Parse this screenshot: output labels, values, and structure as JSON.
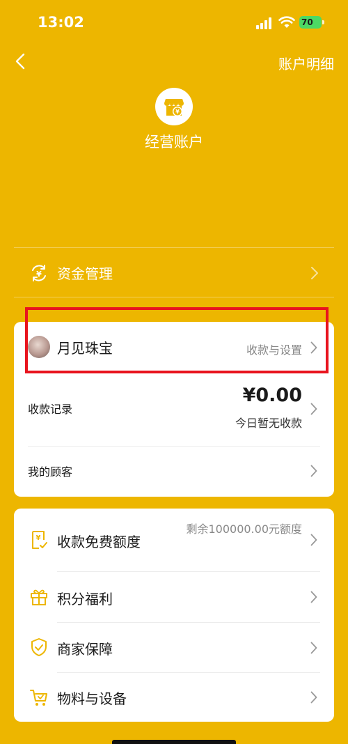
{
  "status_bar": {
    "time": "13:02",
    "battery": "70"
  },
  "nav": {
    "right_label": "账户明细"
  },
  "hero": {
    "title": "经营账户",
    "icon": "shop-yen-icon"
  },
  "fund": {
    "label": "资金管理",
    "icon": "yen-cycle-icon"
  },
  "merchant": {
    "name": "月见珠宝",
    "link_label": "收款与设置"
  },
  "records": {
    "label": "收款记录",
    "amount": "¥0.00",
    "subtext": "今日暂无收款"
  },
  "customers": {
    "label": "我的顾客"
  },
  "services": [
    {
      "label": "收款免费额度",
      "note": "剩余100000.00元额度",
      "icon": "yen-receipt-icon"
    },
    {
      "label": "积分福利",
      "icon": "gift-icon"
    },
    {
      "label": "商家保障",
      "icon": "shield-check-icon"
    },
    {
      "label": "物料与设备",
      "icon": "cart-icon"
    }
  ],
  "colors": {
    "background": "#EDB600",
    "accent": "#EDB600",
    "highlight": "#E8141E"
  }
}
